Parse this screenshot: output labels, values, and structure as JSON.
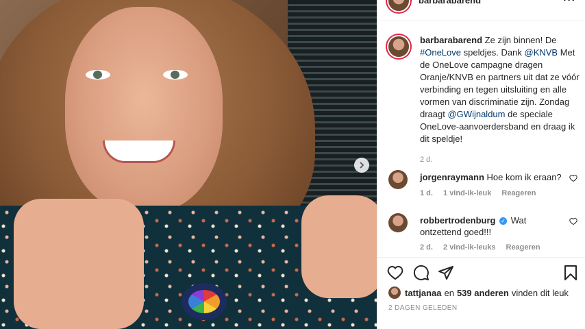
{
  "post_header": {
    "username": "barbarabarend",
    "menu_icon": "more-icon"
  },
  "caption": {
    "username": "barbarabarend",
    "part1": " Ze zijn binnen! De ",
    "hashtag": "#OneLove",
    "part2": " speldjes. Dank ",
    "mention1": "@KNVB",
    "part3": " Met de OneLove campagne dragen Oranje/KNVB en partners uit dat ze vóór verbinding en tegen uitsluiting en alle vormen van discriminatie zijn. Zondag draagt ",
    "mention2": "@GWijnaldum",
    "part4": " de speciale OneLove-aanvoerdersband en draag ik dit speldje!",
    "age": "2 d."
  },
  "comments": [
    {
      "username": "jorgenraymann",
      "text": "Hoe kom ik eraan?",
      "age": "1 d.",
      "likes": "1 vind-ik-leuk",
      "reply": "Reageren",
      "verified": false
    },
    {
      "username": "robbertrodenburg",
      "text": "Wat ontzettend goed!!!",
      "age": "2 d.",
      "likes": "2 vind-ik-leuks",
      "reply": "Reageren",
      "verified": true
    }
  ],
  "likes_line": {
    "user": "tattjanaa",
    "connector": "en",
    "count": "539 anderen",
    "suffix": "vinden dit leuk"
  },
  "post_date": "2 DAGEN GELEDEN",
  "icons": {
    "like": "heart-icon",
    "comment": "comment-icon",
    "share": "share-icon",
    "save": "bookmark-icon",
    "next": "chevron-right-icon"
  },
  "colors": {
    "link": "#00376b",
    "verified": "#3897f0",
    "story_ring": "#dc2743"
  }
}
